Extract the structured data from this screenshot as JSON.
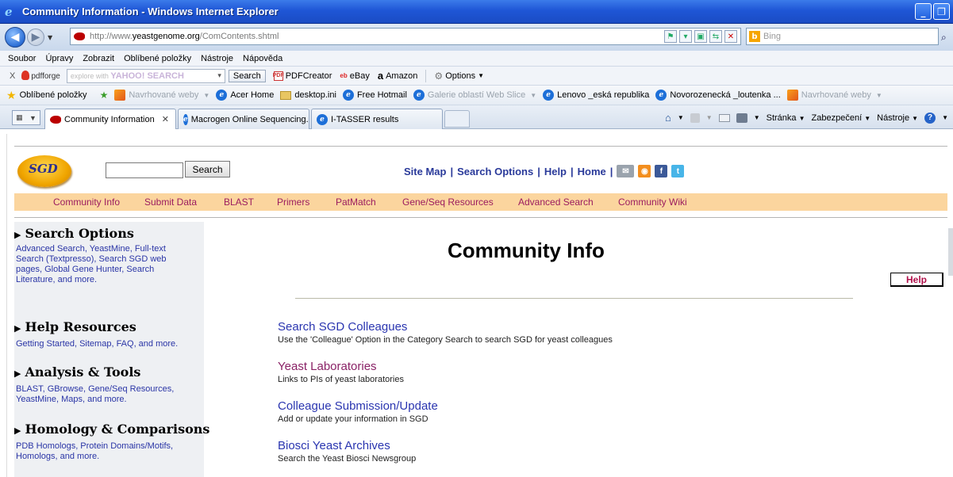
{
  "window": {
    "title": "Community Information - Windows Internet Explorer",
    "controls": [
      "_",
      "❐",
      "✕"
    ]
  },
  "address": {
    "url_prefix": "http://www.",
    "url_domain": "yeastgenome.org",
    "url_path": "/ComContents.shtml",
    "search_placeholder": "Bing"
  },
  "menu": [
    "Soubor",
    "Úpravy",
    "Zobrazit",
    "Oblíbené položky",
    "Nástroje",
    "Nápověda"
  ],
  "pdfbar": {
    "close": "X",
    "brand": "pdfforge",
    "search_hint": "explore with",
    "search_brand": "YAHOO! SEARCH",
    "search_button": "Search",
    "items": [
      "PDFCreator",
      "eBay",
      "Amazon",
      "Options"
    ]
  },
  "favorites": {
    "label": "Oblíbené položky",
    "items": [
      {
        "label": "Navrhované weby",
        "grey": true
      },
      {
        "label": "Acer Home",
        "grey": false
      },
      {
        "label": "desktop.ini",
        "grey": false
      },
      {
        "label": "Free Hotmail",
        "grey": false
      },
      {
        "label": "Galerie oblastí Web Slice",
        "grey": true
      },
      {
        "label": "Lenovo _eská republika",
        "grey": false
      },
      {
        "label": "Novorozenecká _loutenka ...",
        "grey": false
      },
      {
        "label": "Navrhované weby",
        "grey": true
      }
    ]
  },
  "tabs": [
    {
      "label": "Community Information",
      "active": true
    },
    {
      "label": "Macrogen Online Sequencing...",
      "active": false
    },
    {
      "label": "I-TASSER results",
      "active": false
    }
  ],
  "commandbar": [
    "Stránka",
    "Zabezpečení",
    "Nástroje"
  ],
  "sgd": {
    "logo_text": "SGD",
    "search_button": "Search",
    "top_links": [
      "Site Map",
      "Search Options",
      "Help",
      "Home"
    ],
    "nav": [
      "Community Info",
      "Submit Data",
      "BLAST",
      "Primers",
      "PatMatch",
      "Gene/Seq Resources",
      "Advanced Search",
      "Community Wiki"
    ]
  },
  "sidebar": [
    {
      "heading": "Search Options",
      "text": "Advanced Search, YeastMine, Full-text Search (Textpresso), Search SGD web pages, Global Gene Hunter, Search Literature, and more."
    },
    {
      "heading": "Help Resources",
      "text": "Getting Started, Sitemap, FAQ, and more."
    },
    {
      "heading": "Analysis & Tools",
      "text": "BLAST, GBrowse, Gene/Seq Resources, YeastMine, Maps, and more."
    },
    {
      "heading": "Homology & Comparisons",
      "text": "PDB Homologs, Protein Domains/Motifs, Homologs, and more."
    }
  ],
  "main": {
    "title": "Community Info",
    "help_button": "Help",
    "results": [
      {
        "title": "Search SGD Colleagues",
        "desc": "Use the 'Colleague' Option in the Category Search to search SGD for yeast colleagues",
        "visited": false
      },
      {
        "title": "Yeast Laboratories",
        "desc": "Links to PIs of yeast laboratories",
        "visited": true
      },
      {
        "title": "Colleague Submission/Update",
        "desc": "Add or update your information in SGD",
        "visited": false
      },
      {
        "title": "Biosci Yeast Archives",
        "desc": "Search the Yeast Biosci Newsgroup",
        "visited": false
      }
    ]
  }
}
